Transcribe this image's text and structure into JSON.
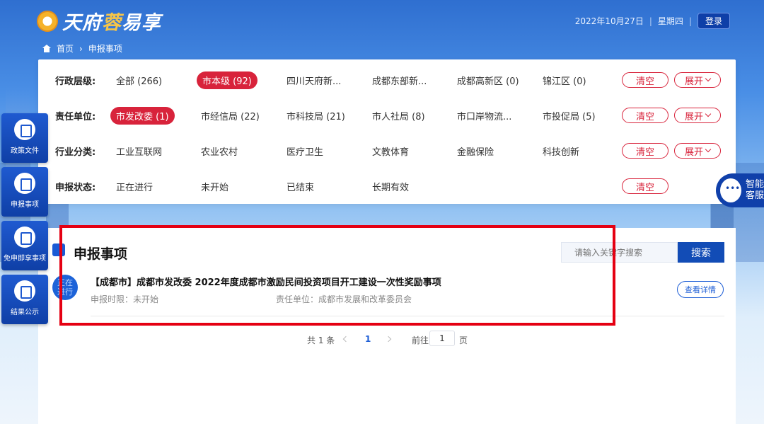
{
  "header": {
    "logo": {
      "part1": "天府",
      "part2": "蓉",
      "part3": "易享"
    },
    "date": "2022年10月27日",
    "weekday": "星期四",
    "login_label": "登录"
  },
  "breadcrumb": {
    "home": "首页",
    "current": "申报事项"
  },
  "filters": {
    "level": {
      "label": "行政层级:",
      "options": [
        "全部 (266)",
        "市本级 (92)",
        "四川天府新...",
        "成都东部新...",
        "成都高新区 (0)",
        "锦江区 (0)"
      ],
      "active": 1
    },
    "unit": {
      "label": "责任单位:",
      "options": [
        "市发改委 (1)",
        "市经信局 (22)",
        "市科技局 (21)",
        "市人社局 (8)",
        "市口岸物流...",
        "市投促局 (5)"
      ],
      "active": 0
    },
    "industry": {
      "label": "行业分类:",
      "options": [
        "工业互联网",
        "农业农村",
        "医疗卫生",
        "文教体育",
        "金融保险",
        "科技创新"
      ]
    },
    "status": {
      "label": "申报状态:",
      "options": [
        "正在进行",
        "未开始",
        "已结束",
        "长期有效"
      ]
    },
    "clear_label": "清空",
    "expand_label": "展开"
  },
  "section": {
    "title": "申报事项",
    "search_placeholder": "请输入关键字搜索",
    "search_button": "搜索"
  },
  "items": [
    {
      "status_line1": "正在",
      "status_line2": "进行",
      "title": "【成都市】成都市发改委 2022年度成都市激励民间投资项目开工建设一次性奖励事项",
      "deadline": "申报时限：未开始",
      "unit": "责任单位：成都市发展和改革委员会",
      "detail_button": "查看详情"
    }
  ],
  "pagination": {
    "total": "共 1 条",
    "current": "1",
    "goto_label": "前往",
    "page_value": "1",
    "page_suffix": "页"
  },
  "sidebar": [
    {
      "label": "政策文件",
      "icon": "policy-doc-icon"
    },
    {
      "label": "申报事项",
      "icon": "application-icon"
    },
    {
      "label": "免申即享事项",
      "icon": "instant-benefit-icon"
    },
    {
      "label": "结果公示",
      "icon": "result-announce-icon"
    }
  ],
  "assistant": {
    "line1": "智能",
    "line2": "客服"
  },
  "colors": {
    "accent_red": "#d8233b",
    "primary_blue": "#124cb6",
    "highlight_box": "#e50012"
  }
}
